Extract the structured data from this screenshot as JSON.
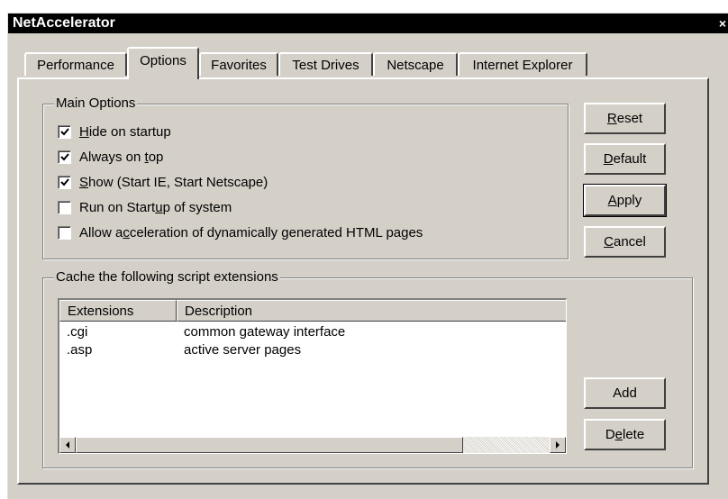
{
  "window": {
    "title": "NetAccelerator",
    "close_glyph": "×"
  },
  "tabs": [
    {
      "label": "Performance",
      "active": false
    },
    {
      "label": "Options",
      "active": true
    },
    {
      "label": "Favorites",
      "active": false
    },
    {
      "label": "Test Drives",
      "active": false
    },
    {
      "label": "Netscape",
      "active": false
    },
    {
      "label": "Internet Explorer",
      "active": false
    }
  ],
  "main_options": {
    "legend": "Main Options",
    "items": [
      {
        "pre": "",
        "key": "H",
        "post": "ide on startup",
        "checked": true
      },
      {
        "pre": "Always on ",
        "key": "t",
        "post": "op",
        "checked": true
      },
      {
        "pre": "",
        "key": "S",
        "post": "how (Start IE, Start Netscape)",
        "checked": true
      },
      {
        "pre": "Run on Start",
        "key": "u",
        "post": "p of system",
        "checked": false
      },
      {
        "pre": "Allow a",
        "key": "c",
        "post": "celeration of dynamically generated HTML pages",
        "checked": false
      }
    ]
  },
  "buttons": {
    "reset": {
      "key": "R",
      "rest": "eset"
    },
    "default": {
      "key": "D",
      "rest": "efault"
    },
    "apply": {
      "key": "A",
      "rest": "pply"
    },
    "cancel": {
      "key": "C",
      "rest": "ancel"
    },
    "add": {
      "label": "Add"
    },
    "delete": {
      "pre": "D",
      "key": "e",
      "post": "lete"
    }
  },
  "cache": {
    "legend": "Cache the following script extensions",
    "columns": [
      "Extensions",
      "Description"
    ],
    "rows": [
      {
        "ext": ".cgi",
        "desc": "common gateway interface"
      },
      {
        "ext": ".asp",
        "desc": "active server pages"
      }
    ]
  },
  "icons": {
    "check": "check-icon",
    "scroll_left": "arrow-left-icon",
    "scroll_right": "arrow-right-icon",
    "close": "close-icon"
  },
  "colors": {
    "titlebar": "#000000",
    "face": "#d4d0c8"
  }
}
